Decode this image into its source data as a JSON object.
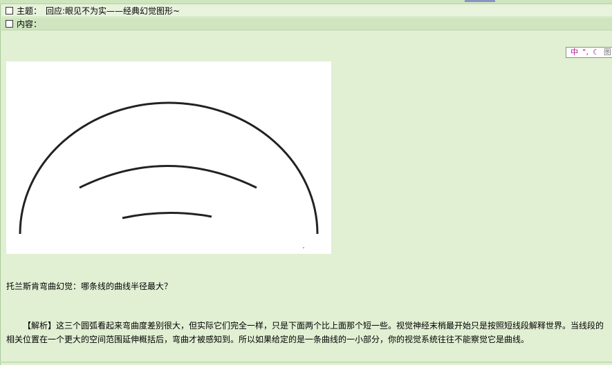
{
  "post": {
    "subject_label": "主题：",
    "subject_value": "回应:眼见不为实——经典幻觉图形~",
    "content_label": "内容："
  },
  "toolbar": {
    "icon1": "中",
    "icon2": "°,",
    "icon3": "♉",
    "icon4": "图"
  },
  "caption": "托兰斯肯弯曲幻觉：哪条线的曲线半径最大？",
  "body_text": "【解析】这三个圆弧看起来弯曲度差别很大，但实际它们完全一样，只是下面两个比上面那个短一些。视觉神经末梢最开始只是按照短线段解释世界。当线段的相关位置在一个更大的空间范围延伸概括后，弯曲才被感知到。所以如果给定的是一条曲线的一小部分，你的视觉系统往往不能察觉它是曲线。",
  "colors": {
    "background": "#e1efd3",
    "content_row": "#cfe5bf",
    "toolbar_accent": "#b0148c"
  }
}
